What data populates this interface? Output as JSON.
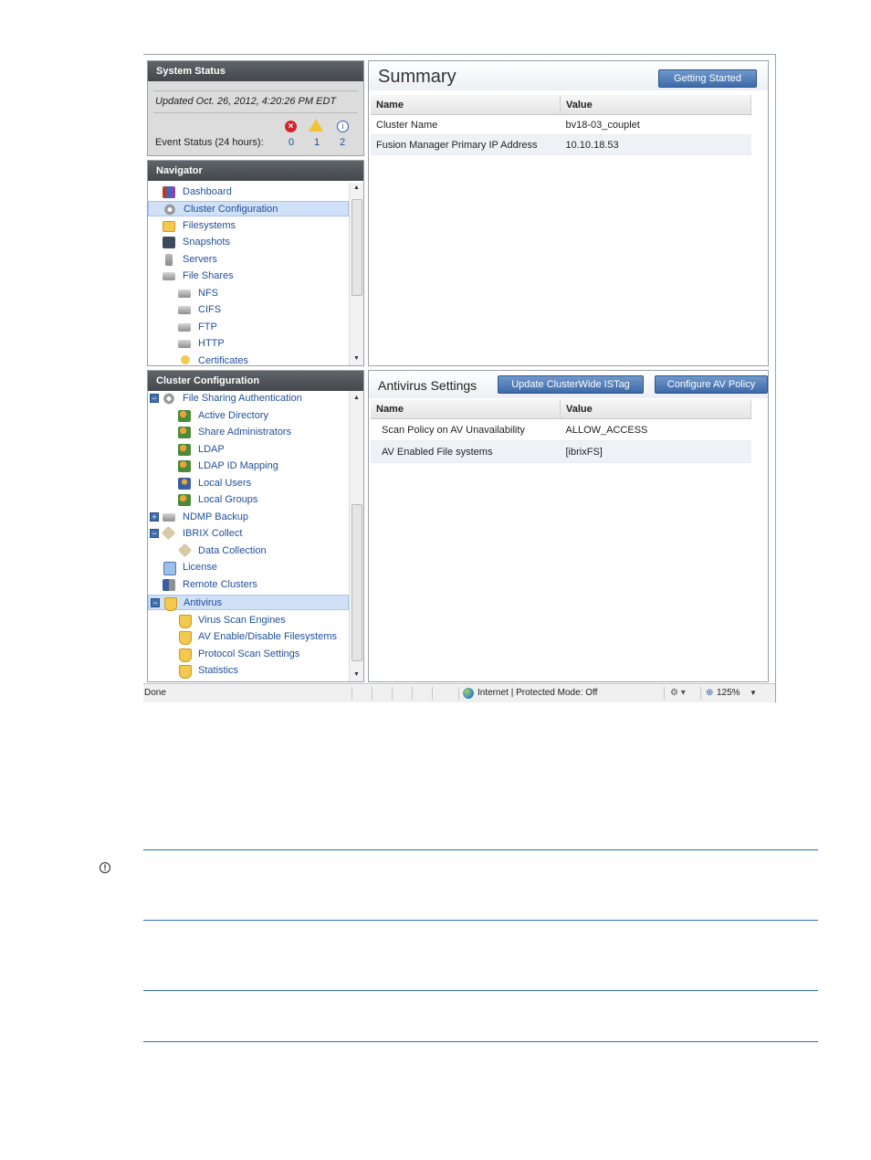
{
  "system_status": {
    "title": "System Status",
    "updated": "Updated Oct. 26, 2012, 4:20:26 PM EDT",
    "event_label": "Event Status (24 hours):",
    "counts": {
      "errors": "0",
      "warnings": "1",
      "info": "2"
    }
  },
  "navigator": {
    "title": "Navigator",
    "items": [
      {
        "label": "Dashboard",
        "icon": "dashboard-icon"
      },
      {
        "label": "Cluster Configuration",
        "icon": "gear-icon"
      },
      {
        "label": "Filesystems",
        "icon": "folder-icon"
      },
      {
        "label": "Snapshots",
        "icon": "camera-icon"
      },
      {
        "label": "Servers",
        "icon": "server-icon"
      },
      {
        "label": "File Shares",
        "icon": "share-icon"
      },
      {
        "label": "NFS",
        "icon": "share-icon"
      },
      {
        "label": "CIFS",
        "icon": "share-icon"
      },
      {
        "label": "FTP",
        "icon": "share-icon"
      },
      {
        "label": "HTTP",
        "icon": "share-icon"
      },
      {
        "label": "Certificates",
        "icon": "certificate-icon"
      }
    ]
  },
  "cluster_config": {
    "title": "Cluster Configuration",
    "items": [
      {
        "label": "File Sharing Authentication"
      },
      {
        "label": "Active Directory"
      },
      {
        "label": "Share Administrators"
      },
      {
        "label": "LDAP"
      },
      {
        "label": "LDAP ID Mapping"
      },
      {
        "label": "Local Users"
      },
      {
        "label": "Local Groups"
      },
      {
        "label": "NDMP Backup"
      },
      {
        "label": "IBRIX Collect"
      },
      {
        "label": "Data Collection"
      },
      {
        "label": "License"
      },
      {
        "label": "Remote Clusters"
      },
      {
        "label": "Antivirus"
      },
      {
        "label": "Virus Scan Engines"
      },
      {
        "label": "AV Enable/Disable Filesystems"
      },
      {
        "label": "Protocol Scan Settings"
      },
      {
        "label": "Statistics"
      }
    ]
  },
  "summary": {
    "title": "Summary",
    "button": "Getting Started",
    "columns": [
      "Name",
      "Value"
    ],
    "rows": [
      [
        "Cluster Name",
        "bv18-03_couplet"
      ],
      [
        "Fusion Manager Primary IP Address",
        "10.10.18.53"
      ]
    ]
  },
  "antivirus": {
    "title": "Antivirus Settings",
    "button_update": "Update ClusterWide ISTag",
    "button_configure": "Configure AV Policy",
    "columns": [
      "Name",
      "Value"
    ],
    "rows": [
      [
        "Scan Policy on AV Unavailability",
        "ALLOW_ACCESS"
      ],
      [
        "AV Enabled File systems",
        "[ibrixFS]"
      ]
    ]
  },
  "statusbar": {
    "left": "Done",
    "zone": "Internet | Protected Mode: Off",
    "zoom": "125%"
  },
  "colors": {
    "accent": "#3d6aa8",
    "selection": "#cfe0f7",
    "link": "#1f4f99"
  }
}
